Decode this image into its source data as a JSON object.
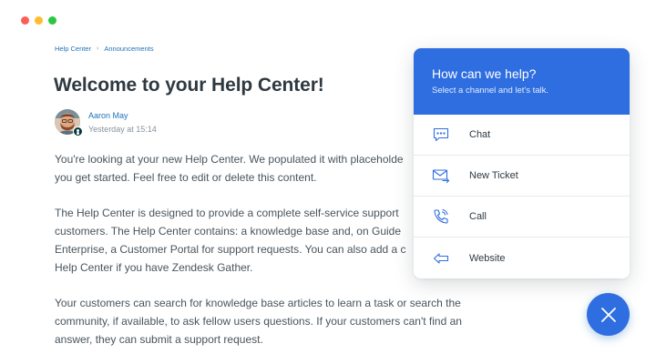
{
  "colors": {
    "accent": "#2f6ee0",
    "link": "#1f73b7",
    "text": "#2f3941",
    "muted": "#87929d",
    "traffic_red": "#fd5f57",
    "traffic_yellow": "#febc2e",
    "traffic_green": "#28c840"
  },
  "breadcrumb": {
    "items": [
      "Help Center",
      "Announcements"
    ],
    "separator": "›"
  },
  "article": {
    "title": "Welcome to your Help Center!",
    "author": {
      "name": "Aaron May",
      "time": "Yesterday at 15:14",
      "avatar_icon": "avatar-photo"
    },
    "paragraphs": [
      {
        "lines": [
          "You're looking at your new Help Center. We populated it with placeholde",
          "you get started. Feel free to edit or delete this content."
        ]
      },
      {
        "lines": [
          "The Help Center is designed to provide a complete self-service support",
          "customers. The Help Center contains: a knowledge base and, on Guide",
          "Enterprise, a Customer Portal for support requests. You can also add a c",
          "Help Center if you have Zendesk Gather."
        ]
      },
      {
        "lines": [
          "Your customers can search for knowledge base articles to learn a task or search the",
          "community, if available, to ask fellow users questions. If your customers can't find an",
          "answer, they can submit a support request."
        ]
      }
    ]
  },
  "widget": {
    "title": "How can we help?",
    "subtitle": "Select a channel and let's talk.",
    "channels": [
      {
        "label": "Chat",
        "icon": "chat-icon"
      },
      {
        "label": "New Ticket",
        "icon": "envelope-icon"
      },
      {
        "label": "Call",
        "icon": "phone-icon"
      },
      {
        "label": "Website",
        "icon": "arrow-left-icon"
      }
    ],
    "close_icon": "close-icon"
  }
}
